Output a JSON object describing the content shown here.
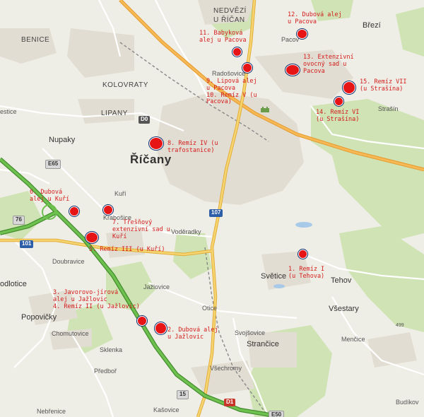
{
  "places": {
    "nedvezi": "NEDVĚZÍ",
    "u_rican": "U ŘÍČAN",
    "brezi": "Březí",
    "benice": "BENICE",
    "pacov": "Pacov",
    "kolovraty": "KOLOVRATY",
    "radosovice": "Radošovice",
    "lipany": "LIPANY",
    "pestice": "estice",
    "strasin": "Strašín",
    "nupaky": "Nupaky",
    "rican": "Říčany",
    "kuri": "Kuří",
    "krabosice": "Krabošice",
    "voderadky": "Voděradky",
    "doubravice": "Doubravice",
    "svetice": "Světice",
    "tehov": "Tehov",
    "popovicky": "Popovičky",
    "jazlovice": "Jažlovice",
    "otice": "Otice",
    "vsestary": "Všestary",
    "modlotice": "odlotice",
    "chomutovice": "Chomutovice",
    "svojsovice": "Svojšovice",
    "mencice": "Menčice",
    "sklenka": "Sklenka",
    "strancice": "Strančice",
    "predbor": "Předboř",
    "vsechromy": "Všechromy",
    "nebrenice": "Nebřenice",
    "kasovice": "Kašovice",
    "budikov": "Budíkov"
  },
  "shields": {
    "d0": "D0",
    "r107": "107",
    "r101": "101",
    "e65": "E65",
    "r76": "76",
    "e15": "15",
    "d1": "D1",
    "e50": "E50"
  },
  "elevation": "499",
  "sites": {
    "s1": [
      "1. Remíz I",
      "(u Tehova)"
    ],
    "s2": [
      "2. Dubová alej",
      "u Jažlovic"
    ],
    "s3": [
      "3. Javorovo-jírová",
      "alej u Jažlovic",
      "4. Remíz II (u Jažlovic)"
    ],
    "s5": [
      "5. Remíz III (u Kuří)"
    ],
    "s6": [
      "6. Dubová",
      "alej u Kuří"
    ],
    "s7": [
      "7. Třešňový",
      "extenzivní sad u",
      "Kuří"
    ],
    "s8": [
      "8. Remíz IV (u",
      "trafostanice)"
    ],
    "s9": [
      "9. Lipová alej",
      "u Pacova",
      "10. Remíz V (u",
      "Pacova)"
    ],
    "s11": [
      "11. Babyková",
      "alej u Pacova"
    ],
    "s12": [
      "12. Dubová alej",
      "u Pacova"
    ],
    "s13": [
      "13. Extenzivní",
      "ovocný sad u",
      "Pacova"
    ],
    "s14": [
      "14. Remíz VI",
      "(u Strašína)"
    ],
    "s15": [
      "15. Remíz VII",
      "(u Strašína)"
    ]
  },
  "colors": {
    "marker": "#e61414",
    "marker_ring": "#0b2a6b",
    "site_text": "#d41c1c",
    "motorway": "#57a83a",
    "primary_road": "#f5c542",
    "highway_orange": "#f2a03a"
  }
}
